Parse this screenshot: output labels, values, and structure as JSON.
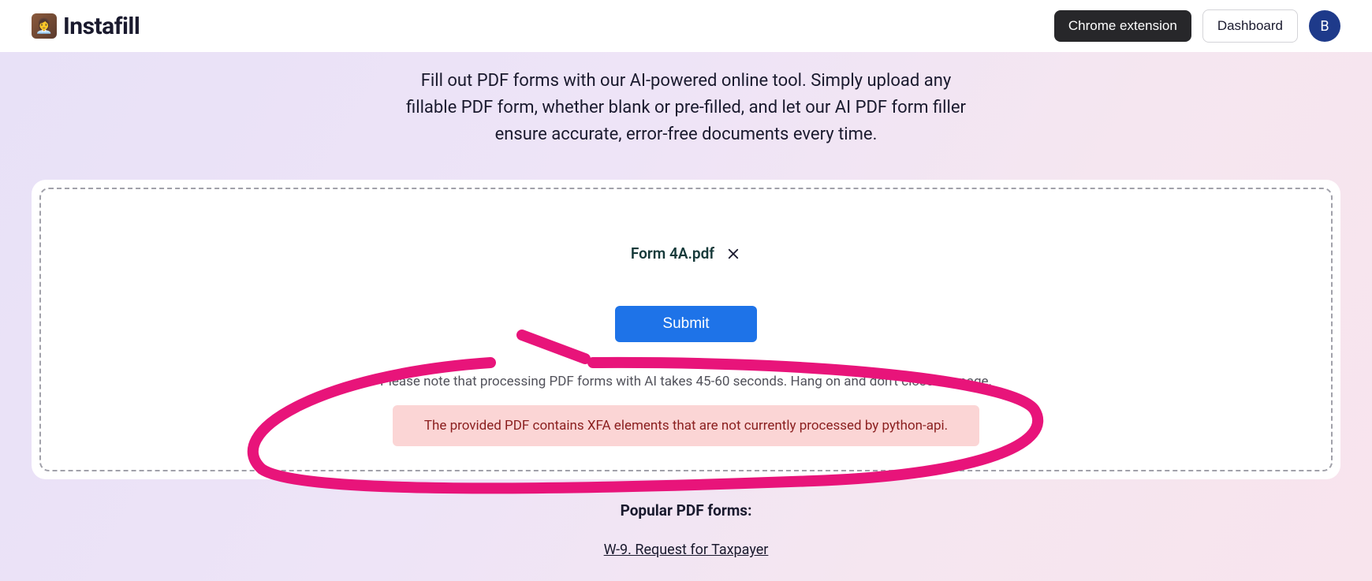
{
  "header": {
    "logo_text": "Instafill",
    "chrome_ext": "Chrome extension",
    "dashboard": "Dashboard",
    "avatar_letter": "B"
  },
  "hero": {
    "description": "Fill out PDF forms with our AI-powered online tool. Simply upload any fillable PDF form, whether blank or pre-filled, and let our AI PDF form filler ensure accurate, error-free documents every time."
  },
  "upload": {
    "file_name": "Form 4A.pdf",
    "submit_label": "Submit",
    "note": "Please note that processing PDF forms with AI takes 45-60 seconds. Hang on and don't close the page.",
    "error_message": "The provided PDF contains XFA elements that are not currently processed by python-api."
  },
  "popular": {
    "title": "Popular PDF forms:",
    "link1": "W-9. Request for Taxpayer"
  }
}
